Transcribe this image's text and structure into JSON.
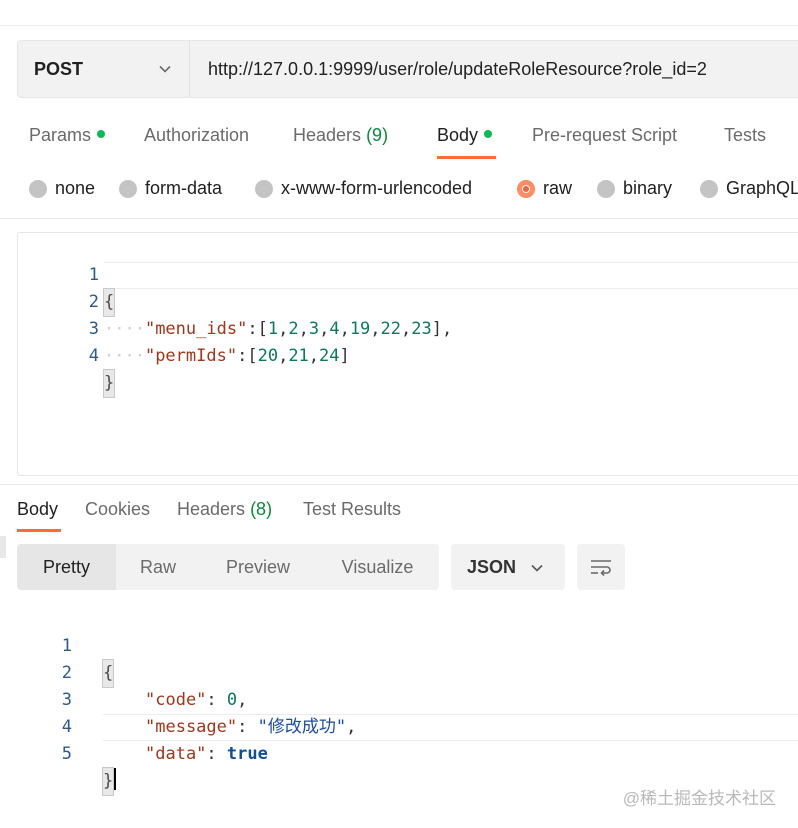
{
  "request": {
    "method": "POST",
    "url": "http://127.0.0.1:9999/user/role/updateRoleResource?role_id=2"
  },
  "request_tabs": [
    {
      "label": "Params",
      "dot": true
    },
    {
      "label": "Authorization"
    },
    {
      "label": "Headers",
      "count": "(9)"
    },
    {
      "label": "Body",
      "dot": true,
      "active": true
    },
    {
      "label": "Pre-request Script"
    },
    {
      "label": "Tests"
    }
  ],
  "body_types": [
    {
      "label": "none",
      "checked": false
    },
    {
      "label": "form-data",
      "checked": false
    },
    {
      "label": "x-www-form-urlencoded",
      "checked": false
    },
    {
      "label": "raw",
      "checked": true
    },
    {
      "label": "binary",
      "checked": false
    },
    {
      "label": "GraphQL",
      "checked": false
    }
  ],
  "request_body": {
    "line_numbers": [
      "1",
      "2",
      "3",
      "4"
    ],
    "open_brace": "{",
    "close_brace": "}",
    "indent": "····",
    "menu_ids_key": "\"menu_ids\"",
    "menu_ids_values": [
      "1",
      "2",
      "3",
      "4",
      "19",
      "22",
      "23"
    ],
    "perm_ids_key": "\"permIds\"",
    "perm_ids_values": [
      "20",
      "21",
      "24"
    ],
    "colon": ":",
    "comma": ",",
    "lbracket": "[",
    "rbracket": "]"
  },
  "response_tabs": [
    {
      "label": "Body",
      "active": true
    },
    {
      "label": "Cookies"
    },
    {
      "label": "Headers",
      "count": "(8)"
    },
    {
      "label": "Test Results"
    }
  ],
  "view_modes": [
    "Pretty",
    "Raw",
    "Preview",
    "Visualize"
  ],
  "active_view": "Pretty",
  "format": "JSON",
  "response_body": {
    "line_numbers": [
      "1",
      "2",
      "3",
      "4",
      "5"
    ],
    "open_brace": "{",
    "close_brace": "}",
    "code_key": "\"code\"",
    "code_value": "0",
    "message_key": "\"message\"",
    "message_value": "\"修改成功\"",
    "data_key": "\"data\"",
    "data_value": "true",
    "colon": ": ",
    "comma": ","
  },
  "watermark": "@稀土掘金技术社区",
  "icons": {
    "method_dropdown": "chevron-down-icon",
    "format_dropdown": "chevron-down-icon",
    "wrap": "wrap-lines-icon"
  },
  "colors": {
    "accent": "#ff6c37",
    "dot_green": "#0cbb52",
    "key": "#a1371a",
    "number": "#0a7a5e",
    "string": "#1c4fa3"
  }
}
